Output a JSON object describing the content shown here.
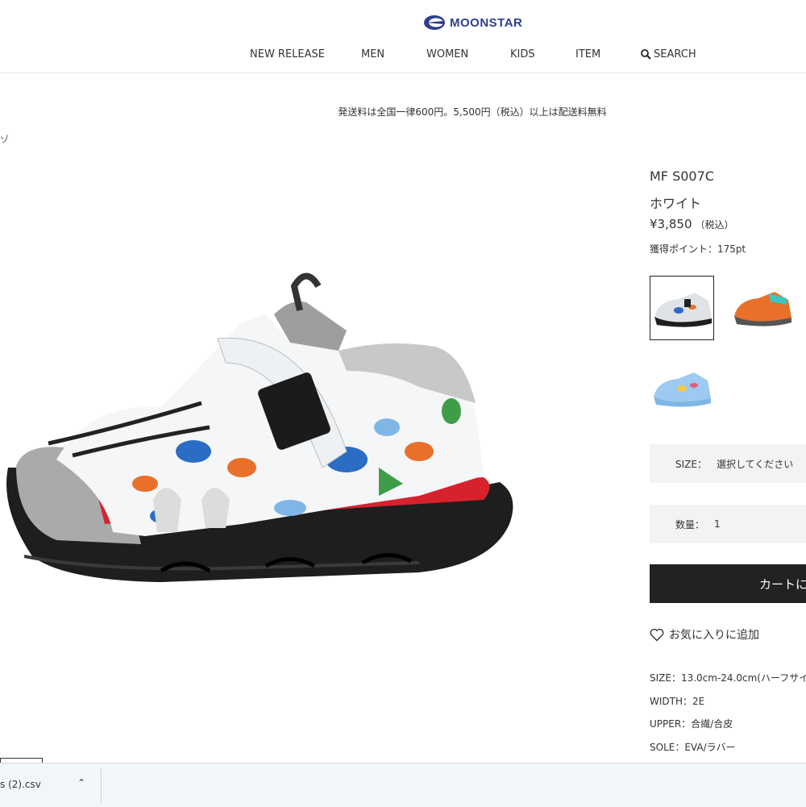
{
  "header": {
    "logo_text": "MOONSTAR",
    "nav": [
      "NEW RELEASE",
      "MEN",
      "WOMEN",
      "KIDS",
      "ITEM"
    ],
    "search_label": "SEARCH"
  },
  "notice": "発送料は全国一律600円。5,500円（税込）以上は配送料無料",
  "breadcrumb_fragment": "ゾ",
  "product": {
    "model": "MF S007C",
    "color_name": "ホワイト",
    "price": "¥3,850",
    "tax_note": "（税込）",
    "points": "獲得ポイント：175pt",
    "size_label": "SIZE：",
    "size_value": "選択してください",
    "qty_label": "数量：",
    "qty_value": "1",
    "cart_label": "カートに",
    "favorite_label": "お気に入りに追加",
    "specs": [
      "SIZE：13.0cm-24.0cm(ハーフサイ",
      "WIDTH：2E",
      "UPPER：合繊/合皮",
      "SOLE：EVA/ラバー"
    ],
    "swatches": [
      {
        "name": "white",
        "accent": "#2b6cc4",
        "selected": true
      },
      {
        "name": "orange",
        "accent": "#e8702a",
        "selected": false
      },
      {
        "name": "blue",
        "accent": "#7fb6e6",
        "selected": false
      }
    ]
  },
  "download": {
    "file_name": "s (2).csv"
  },
  "colors": {
    "brand": "#2d3f8e",
    "cart_bg": "#222222",
    "select_bg": "#f3f3f3"
  }
}
